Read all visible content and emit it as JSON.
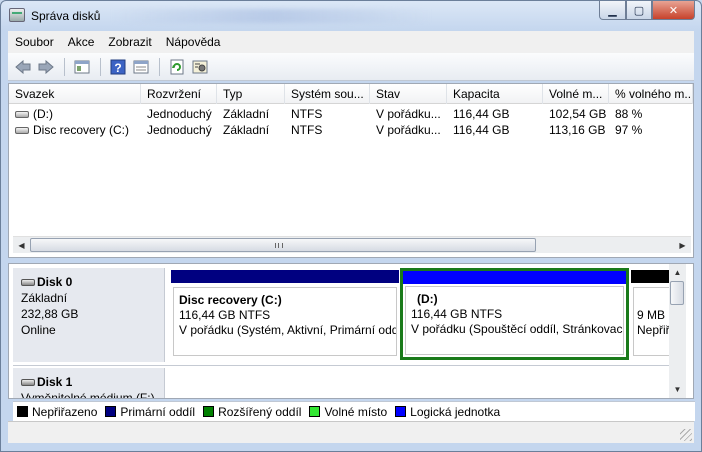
{
  "window": {
    "title": "Správa disků"
  },
  "menu": [
    "Soubor",
    "Akce",
    "Zobrazit",
    "Nápověda"
  ],
  "toolbar": {
    "icons": [
      "back-arrow-icon",
      "forward-arrow-icon",
      "console-tree-icon",
      "help-icon",
      "properties-icon",
      "refresh-icon",
      "settings-icon"
    ]
  },
  "volume_list": {
    "columns": [
      "Svazek",
      "Rozvržení",
      "Typ",
      "Systém sou...",
      "Stav",
      "Kapacita",
      "Volné m...",
      "% volného m..."
    ],
    "rows": [
      {
        "volume": "(D:)",
        "layout": "Jednoduchý",
        "type": "Základní",
        "fs": "NTFS",
        "status": "V pořádku...",
        "capacity": "116,44 GB",
        "free": "102,54 GB",
        "percent": "88 %"
      },
      {
        "volume": "Disc recovery (C:)",
        "layout": "Jednoduchý",
        "type": "Základní",
        "fs": "NTFS",
        "status": "V pořádku...",
        "capacity": "116,44 GB",
        "free": "113,16 GB",
        "percent": "97 %"
      }
    ]
  },
  "disks": [
    {
      "title": "Disk 0",
      "type": "Základní",
      "size": "232,88 GB",
      "state": "Online",
      "partitions": [
        {
          "name": "Disc recovery  (C:)",
          "size": "116,44 GB NTFS",
          "status": "V pořádku (Systém, Aktivní, Primární oddíl)",
          "color": "#000080"
        },
        {
          "name": "(D:)",
          "size": "116,44 GB NTFS",
          "status": "V pořádku (Spouštěcí oddíl, Stránkovací soubor)",
          "color": "#0000ff",
          "selected": true
        },
        {
          "name": "",
          "size": "9 MB",
          "status": "Nepřiřazeno",
          "color": "#000000"
        }
      ]
    },
    {
      "title": "Disk 1",
      "type": "Vyměnitelné médium (F:)"
    }
  ],
  "legend": [
    {
      "label": "Nepřiřazeno",
      "color": "#000000"
    },
    {
      "label": "Primární oddíl",
      "color": "#000080"
    },
    {
      "label": "Rozšířený oddíl",
      "color": "#008000"
    },
    {
      "label": "Volné místo",
      "color": "#33e633"
    },
    {
      "label": "Logická jednotka",
      "color": "#0000ff"
    }
  ]
}
